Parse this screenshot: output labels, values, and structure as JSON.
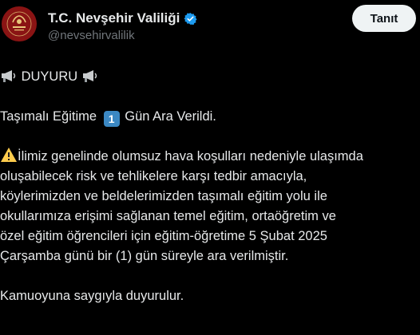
{
  "account": {
    "display_name": "T.C. Nevşehir Valiliği",
    "handle": "@nevsehirvalilik",
    "verified_icon": "verified-badge-icon",
    "avatar_color": "#8a1414"
  },
  "actions": {
    "follow_label": "Tanıt"
  },
  "post": {
    "announcement_label": "DUYURU",
    "headline_before": "Taşımalı Eğitime",
    "headline_number": "1",
    "headline_after": "Gün Ara Verildi.",
    "paragraph_lines": [
      "İlimiz genelinde olumsuz hava koşulları nedeniyle ulaşımda",
      "oluşabilecek risk ve tehlikelere karşı tedbir amacıyla,",
      "köylerimizden ve beldelerimizden taşımalı eğitim yolu ile",
      "okullarımıza erişimi sağlanan temel eğitim, ortaöğretim ve",
      "özel eğitim öğrencileri için eğitim-öğretime 5 Şubat 2025",
      "Çarşamba günü bir (1) gün süreyle ara verilmiştir."
    ],
    "closing": "Kamuoyuna saygıyla duyurulur."
  },
  "colors": {
    "background": "#000000",
    "text": "#e7e9ea",
    "secondary_text": "#71767b",
    "verified_blue": "#1d9bf0",
    "button_bg": "#eff3f4",
    "keycap_blue": "#3b88c3",
    "warning_yellow": "#ffcc4d"
  }
}
